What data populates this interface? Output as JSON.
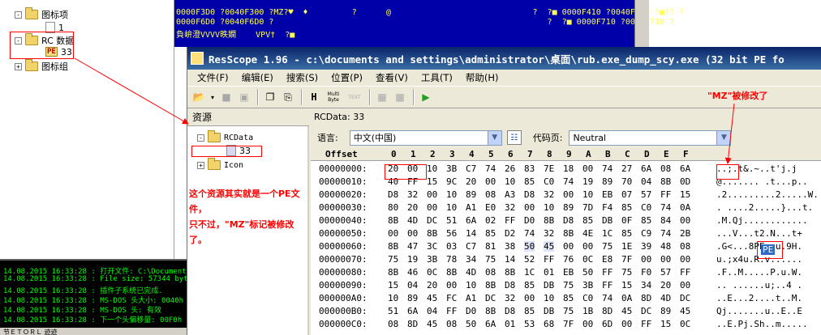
{
  "bg_tree": {
    "items": [
      {
        "expander": "-",
        "label": "图标项"
      },
      {
        "label": "1"
      },
      {
        "expander": "-",
        "label": "RC 数据"
      },
      {
        "label": "33",
        "badge": "PE"
      },
      {
        "expander": "+",
        "label": "图标组"
      }
    ]
  },
  "bg_hex": {
    "lines": [
      "0000F3D0 ?0040F300 ?MZ?♥  ♦         ?      @                             ?  ?■ 0000F410 ?0040F410 ?■?? ?",
      "0000F6D0 ?0040F6D0 ?                                                        ?  ?■ 0000F710 ?0040F710 ?",
      "負峅澄VVVV昳嫻    VPV†  ?■"
    ]
  },
  "log": {
    "lines": [
      "14.08.2015 16:33:28 : 打开文件: C:\\Documents",
      "14.08.2015 16:33:28 : File size: 57344 bytes.",
      "14.08.2015 16:33:28 : 插件子系统已完成.",
      "14.08.2015 16:33:28 : MS-DOS 头大小: 0040h",
      "14.08.2015 16:33:28 : MS-DOS 头: 有效",
      "14.08.2015 16:33:28 : 下一个头偏移量: 00F0h"
    ],
    "status": "节ＥＴＯＲＬ  迹迹"
  },
  "window": {
    "title": "ResScope 1.96 - c:\\documents and settings\\administrator\\桌面\\rub.exe_dump_scy.exe (32 bit PE fo",
    "menu": [
      "文件(F)",
      "编辑(E)",
      "搜索(S)",
      "位置(P)",
      "查看(V)",
      "工具(T)",
      "帮助(H)"
    ],
    "toolbar_multibyte": "Multi Byte",
    "toolbar_text": "TEXT"
  },
  "resources": {
    "header": "资源",
    "tree": [
      {
        "expander": "-",
        "label": "RCData"
      },
      {
        "label": "33"
      },
      {
        "expander": "+",
        "label": "Icon"
      }
    ]
  },
  "detail": {
    "header": "RCData: 33",
    "language_label": "语言:",
    "language_value": "中文(中国)",
    "codepage_label": "代码页:",
    "codepage_value": "Neutral"
  },
  "hex": {
    "header_offset": "Offset",
    "columns": [
      "0",
      "1",
      "2",
      "3",
      "4",
      "5",
      "6",
      "7",
      "8",
      "9",
      "A",
      "B",
      "C",
      "D",
      "E",
      "F"
    ],
    "rows": [
      {
        "offset": "00000000:",
        "bytes": [
          "20",
          "00",
          "10",
          "3B",
          "C7",
          "74",
          "26",
          "83",
          "7E",
          "18",
          "00",
          "74",
          "27",
          "6A",
          "08",
          "6A"
        ],
        "ascii": " ..;.t&.~..t'j.j"
      },
      {
        "offset": "00000010:",
        "bytes": [
          "40",
          "FF",
          "15",
          "9C",
          "20",
          "00",
          "10",
          "85",
          "C0",
          "74",
          "19",
          "89",
          "70",
          "04",
          "8B",
          "0D"
        ],
        "ascii": "@....... .t...p.."
      },
      {
        "offset": "00000020:",
        "bytes": [
          "D8",
          "32",
          "00",
          "10",
          "89",
          "08",
          "A3",
          "D8",
          "32",
          "00",
          "10",
          "EB",
          "07",
          "57",
          "FF",
          "15"
        ],
        "ascii": ".2.........2.....W.."
      },
      {
        "offset": "00000030:",
        "bytes": [
          "80",
          "20",
          "00",
          "10",
          "A1",
          "E0",
          "32",
          "00",
          "10",
          "89",
          "7D",
          "F4",
          "85",
          "C0",
          "74",
          "0A"
        ],
        "ascii": ". ....2.....}...t."
      },
      {
        "offset": "00000040:",
        "bytes": [
          "8B",
          "4D",
          "DC",
          "51",
          "6A",
          "02",
          "FF",
          "D0",
          "8B",
          "D8",
          "85",
          "DB",
          "0F",
          "85",
          "84",
          "00"
        ],
        "ascii": ".M.Qj............"
      },
      {
        "offset": "00000050:",
        "bytes": [
          "00",
          "00",
          "8B",
          "56",
          "14",
          "85",
          "D2",
          "74",
          "32",
          "8B",
          "4E",
          "1C",
          "85",
          "C9",
          "74",
          "2B"
        ],
        "ascii": "...V...t2.N...t+"
      },
      {
        "offset": "00000060:",
        "bytes": [
          "8B",
          "47",
          "3C",
          "03",
          "C7",
          "81",
          "38",
          "50",
          "45",
          "00",
          "00",
          "75",
          "1E",
          "39",
          "48",
          "08"
        ],
        "ascii": ".G<...8PE..u.9H."
      },
      {
        "offset": "00000070:",
        "bytes": [
          "75",
          "19",
          "3B",
          "78",
          "34",
          "75",
          "14",
          "52",
          "FF",
          "76",
          "0C",
          "E8",
          "7F",
          "00",
          "00",
          "00"
        ],
        "ascii": "u.;x4u.R.v......"
      },
      {
        "offset": "00000080:",
        "bytes": [
          "8B",
          "46",
          "0C",
          "8B",
          "4D",
          "08",
          "8B",
          "1C",
          "01",
          "EB",
          "50",
          "FF",
          "75",
          "F0",
          "57",
          "FF"
        ],
        "ascii": ".F..M.....P.u.W."
      },
      {
        "offset": "00000090:",
        "bytes": [
          "15",
          "04",
          "20",
          "00",
          "10",
          "8B",
          "D8",
          "85",
          "DB",
          "75",
          "3B",
          "FF",
          "15",
          "34",
          "20",
          "00"
        ],
        "ascii": ".. ......u;..4 ."
      },
      {
        "offset": "000000A0:",
        "bytes": [
          "10",
          "89",
          "45",
          "FC",
          "A1",
          "DC",
          "32",
          "00",
          "10",
          "85",
          "C0",
          "74",
          "0A",
          "8D",
          "4D",
          "DC"
        ],
        "ascii": "..E...2....t..M."
      },
      {
        "offset": "000000B0:",
        "bytes": [
          "51",
          "6A",
          "04",
          "FF",
          "D0",
          "8B",
          "D8",
          "85",
          "DB",
          "75",
          "1B",
          "8D",
          "45",
          "DC",
          "89",
          "45"
        ],
        "ascii": "Qj.......u..E..E"
      },
      {
        "offset": "000000C0:",
        "bytes": [
          "08",
          "8D",
          "45",
          "08",
          "50",
          "6A",
          "01",
          "53",
          "68",
          "7F",
          "00",
          "6D",
          "00",
          "FF",
          "15",
          "0C"
        ],
        "ascii": "..E.Pj.Sh..m....."
      }
    ],
    "selected_ascii": "PE"
  },
  "annotations": {
    "left_note_lines": [
      "这个资源其实就是一个PE文件，",
      "只不过，\"MZ\"标记被修改了。"
    ],
    "mz_note": "\"MZ\"被修改了",
    "color": "#ff0000"
  }
}
